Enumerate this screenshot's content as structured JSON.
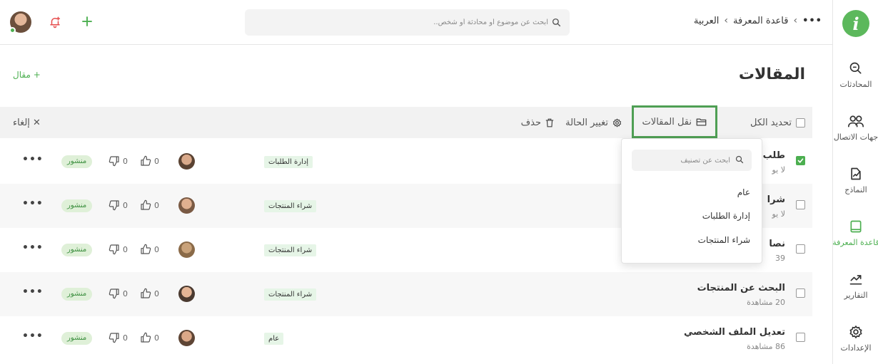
{
  "colors": {
    "accent": "#4caf50",
    "highlight_border": "#4f9f54",
    "status_bg": "#dff0d8",
    "category_bg": "#e6f5e7"
  },
  "sidebar": {
    "logo_letter": "i",
    "items": [
      {
        "label": "المحادثات",
        "icon": "chat-icon"
      },
      {
        "label": "جهات الاتصال",
        "icon": "contacts-icon"
      },
      {
        "label": "النماذج",
        "icon": "forms-icon"
      },
      {
        "label": "قاعدة المعرفة",
        "icon": "book-icon",
        "active": true
      },
      {
        "label": "التقارير",
        "icon": "chart-icon"
      },
      {
        "label": "الإعدادات",
        "icon": "gear-icon"
      }
    ]
  },
  "header": {
    "breadcrumb": {
      "more": "•••",
      "separator": "›",
      "first": "قاعدة المعرفة",
      "second": "العربية"
    },
    "search_placeholder": "ابحث عن موضوع أو محادثة أو شخص..",
    "icons": [
      "avatar",
      "bell-plus-icon",
      "plus-icon"
    ]
  },
  "page": {
    "title": "المقالات",
    "new_article": "+ مقال"
  },
  "toolbar": {
    "select_all": "تحديد الكل",
    "move_articles": "نقل المقالات",
    "change_status": "تغيير الحالة",
    "delete": "حذف",
    "cancel": "✕ إلغاء"
  },
  "dropdown": {
    "search_placeholder": "ابحث عن تصنيف",
    "options": [
      "عام",
      "إدارة الطلبات",
      "شراء المنتجات"
    ]
  },
  "rows": [
    {
      "title": "طلب",
      "views": "لا يو",
      "checked": true,
      "category": "إدارة الطلبات",
      "likes": "0",
      "dislikes": "0",
      "status": "منشور",
      "more": "•••"
    },
    {
      "title": "شرا",
      "views": "لا يو",
      "checked": false,
      "category": "شراء المنتجات",
      "likes": "0",
      "dislikes": "0",
      "status": "منشور",
      "more": "•••"
    },
    {
      "title": "نصا",
      "views": "39",
      "checked": false,
      "category": "شراء المنتجات",
      "likes": "0",
      "dislikes": "0",
      "status": "منشور",
      "more": "•••"
    },
    {
      "title": "البحث عن المنتجات",
      "views": "20 مشاهدة",
      "checked": false,
      "category": "شراء المنتجات",
      "likes": "0",
      "dislikes": "0",
      "status": "منشور",
      "more": "•••"
    },
    {
      "title": "تعديل الملف الشخصي",
      "views": "86 مشاهدة",
      "checked": false,
      "category": "عام",
      "likes": "0",
      "dislikes": "0",
      "status": "منشور",
      "more": "•••"
    }
  ]
}
